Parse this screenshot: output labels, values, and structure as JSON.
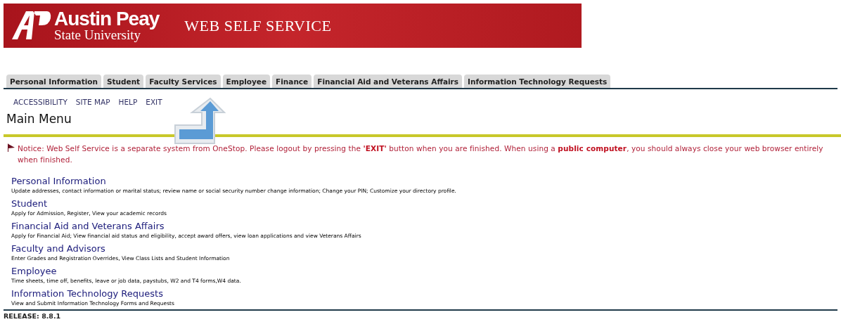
{
  "banner": {
    "logo_top": "Austin Peay",
    "logo_bottom": "State University",
    "title": "WEB SELF SERVICE"
  },
  "tabs": [
    {
      "label": "Personal Information",
      "selected": false
    },
    {
      "label": "Student",
      "selected": false
    },
    {
      "label": "Faculty Services",
      "selected": false
    },
    {
      "label": "Employee",
      "selected": false
    },
    {
      "label": "Finance",
      "selected": false
    },
    {
      "label": "Financial Aid and Veterans Affairs",
      "selected": false
    },
    {
      "label": "Information Technology Requests",
      "selected": false
    }
  ],
  "nav_links": [
    "ACCESSIBILITY",
    "SITE MAP",
    "HELP",
    "EXIT"
  ],
  "page_title": "Main Menu",
  "notice": "Notice: Web Self Service is a separate system from OneStop. Please logout by pressing the **'EXIT'** button when you are finished. When using a **public computer**, you should always close your web browser entirely when finished.",
  "menu": [
    {
      "title": "Personal Information",
      "description": "Update addresses, contact information or marital status; review name or social security number change information; Change your PIN; Customize your directory profile."
    },
    {
      "title": "Student",
      "description": "Apply for Admission, Register, View your academic records"
    },
    {
      "title": "Financial Aid and Veterans Affairs",
      "description": "Apply for Financial Aid; View financial aid status and eligibility, accept award offers, view loan applications and view Veterans Affairs"
    },
    {
      "title": "Faculty and Advisors",
      "description": "Enter Grades and Registration Overrides, View Class Lists and Student Information"
    },
    {
      "title": "Employee",
      "description": "Time sheets, time off, benefits, leave or job data, paystubs, W2 and T4 forms,W4 data."
    },
    {
      "title": "Information Technology Requests",
      "description": "View and Submit Information Technology Forms and Requests"
    }
  ],
  "release": "RELEASE: 8.8.1"
}
